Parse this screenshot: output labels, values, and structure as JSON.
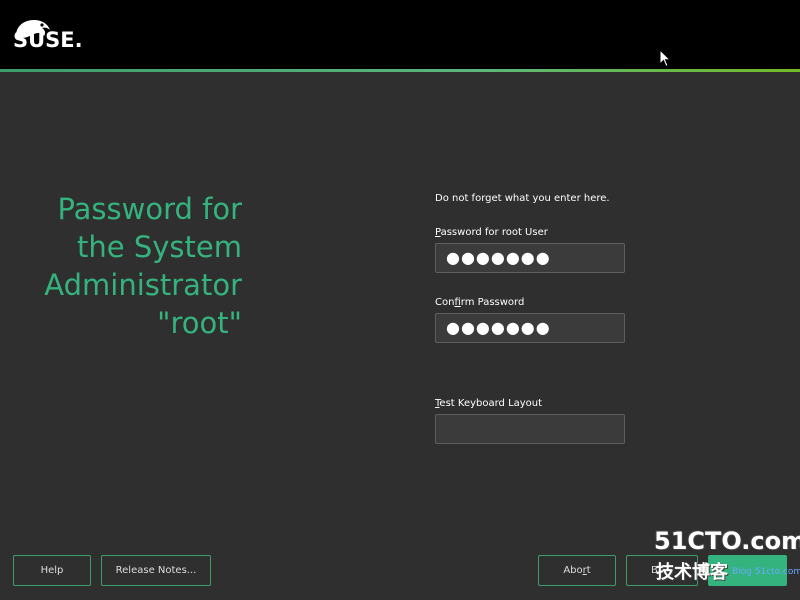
{
  "header": {
    "logo_text": "SUSE."
  },
  "page": {
    "title_lines": [
      "Password for",
      "the System",
      "Administrator",
      "\"root\""
    ],
    "hint": "Do not forget what you enter here."
  },
  "form": {
    "password": {
      "label_accel": "P",
      "label_rest": "assword for root User",
      "value": "●●●●●●●"
    },
    "confirm": {
      "label_pre": "Con",
      "label_accel": "f",
      "label_rest": "irm Password",
      "value": "●●●●●●●"
    },
    "keyboard_test": {
      "label_accel": "T",
      "label_rest": "est Keyboard Layout",
      "value": ""
    }
  },
  "buttons": {
    "help": "Help",
    "release_notes": "Release Notes...",
    "abort_pre": "Abo",
    "abort_accel": "r",
    "abort_rest": "t",
    "back": "B",
    "next": ""
  },
  "watermark": {
    "line1": "51CTO.com",
    "line2": "技术博客",
    "line3": "Blog  51cto.com"
  },
  "colors": {
    "accent": "#35b37e",
    "background": "#2f2f2f",
    "header": "#000000"
  }
}
